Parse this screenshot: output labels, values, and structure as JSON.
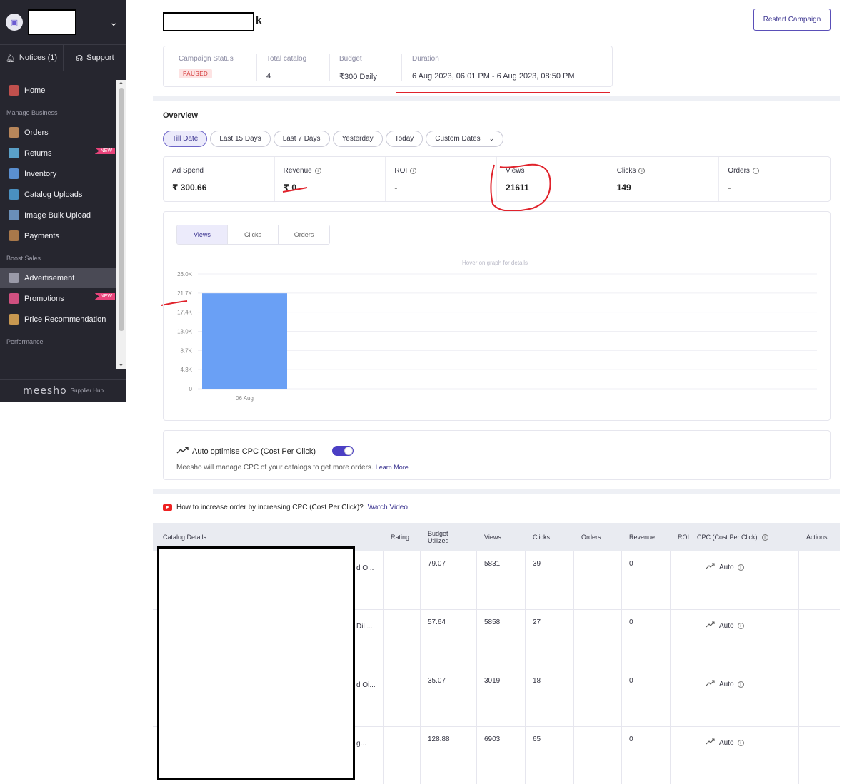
{
  "sidebar": {
    "notices_label": "Notices (1)",
    "support_label": "Support",
    "menu": [
      {
        "type": "item",
        "label": "Home",
        "icon": "home-icon",
        "color": "#c0504d"
      },
      {
        "type": "section",
        "label": "Manage Business"
      },
      {
        "type": "item",
        "label": "Orders",
        "icon": "box-icon",
        "color": "#b8865a"
      },
      {
        "type": "item",
        "label": "Returns",
        "icon": "truck-icon",
        "color": "#5aa0c8",
        "badge": "NEW"
      },
      {
        "type": "item",
        "label": "Inventory",
        "icon": "clipboard-icon",
        "color": "#5a8fd0"
      },
      {
        "type": "item",
        "label": "Catalog Uploads",
        "icon": "upload-icon",
        "color": "#4a90c0"
      },
      {
        "type": "item",
        "label": "Image Bulk Upload",
        "icon": "image-icon",
        "color": "#6a8fb8"
      },
      {
        "type": "item",
        "label": "Payments",
        "icon": "wallet-icon",
        "color": "#a8784a"
      },
      {
        "type": "section",
        "label": "Boost Sales"
      },
      {
        "type": "item",
        "label": "Advertisement",
        "icon": "megaphone-icon",
        "color": "#9a9aa8",
        "active": true
      },
      {
        "type": "item",
        "label": "Promotions",
        "icon": "percent-icon",
        "color": "#d05080",
        "badge": "NEW"
      },
      {
        "type": "item",
        "label": "Price Recommendation",
        "icon": "price-tag-icon",
        "color": "#c89850"
      },
      {
        "type": "section",
        "label": "Performance"
      }
    ],
    "footer_brand": "meesho",
    "footer_sub": "Supplier Hub"
  },
  "header": {
    "title_suffix": "k",
    "restart_label": "Restart Campaign"
  },
  "campaign": {
    "status_label": "Campaign Status",
    "status_value": "PAUSED",
    "catalog_label": "Total catalog",
    "catalog_value": "4",
    "budget_label": "Budget",
    "budget_value": "₹300 Daily",
    "duration_label": "Duration",
    "duration_value": "6 Aug 2023, 06:01 PM - 6 Aug 2023, 08:50 PM"
  },
  "overview": {
    "title": "Overview",
    "filters": [
      "Till Date",
      "Last 15 Days",
      "Last 7 Days",
      "Yesterday",
      "Today",
      "Custom Dates"
    ],
    "active_filter": 0,
    "metrics": [
      {
        "label": "Ad Spend",
        "value": "₹ 300.66",
        "info": false
      },
      {
        "label": "Revenue",
        "value": "₹ 0",
        "info": true
      },
      {
        "label": "ROI",
        "value": "-",
        "info": true
      },
      {
        "label": "Views",
        "value": "21611",
        "info": false
      },
      {
        "label": "Clicks",
        "value": "149",
        "info": true
      },
      {
        "label": "Orders",
        "value": "-",
        "info": true
      }
    ]
  },
  "chart_tabs": [
    "Views",
    "Clicks",
    "Orders"
  ],
  "chart_hint": "Hover on graph for details",
  "chart_data": {
    "type": "bar",
    "categories": [
      "06 Aug"
    ],
    "values": [
      21611
    ],
    "yticks": [
      "0",
      "4.3K",
      "8.7K",
      "13.0K",
      "17.4K",
      "21.7K",
      "26.0K"
    ],
    "ylim": [
      0,
      26000
    ],
    "bar_color": "#6aa0f5",
    "grid": true
  },
  "cpc": {
    "title": "Auto optimise CPC (Cost Per Click)",
    "desc": "Meesho will manage CPC of your catalogs to get more orders.",
    "learn_more": "Learn More"
  },
  "video": {
    "text": "How to increase order by increasing CPC (Cost Per Click)?",
    "link": "Watch Video"
  },
  "table": {
    "headers": [
      "Catalog Details",
      "Rating",
      "Budget Utilized",
      "Views",
      "Clicks",
      "Orders",
      "Revenue",
      "ROI",
      "CPC (Cost Per Click)",
      "Actions"
    ],
    "rows": [
      {
        "name_tail": "d O...",
        "budget": "79.07",
        "views": "5831",
        "clicks": "39",
        "revenue": "0",
        "cpc": "Auto"
      },
      {
        "name_tail": "Dil ...",
        "budget": "57.64",
        "views": "5858",
        "clicks": "27",
        "revenue": "0",
        "cpc": "Auto"
      },
      {
        "name_tail": "d Oi...",
        "budget": "35.07",
        "views": "3019",
        "clicks": "18",
        "revenue": "0",
        "cpc": "Auto"
      },
      {
        "name_tail": "g...",
        "budget": "128.88",
        "views": "6903",
        "clicks": "65",
        "revenue": "0",
        "cpc": "Auto"
      }
    ]
  }
}
